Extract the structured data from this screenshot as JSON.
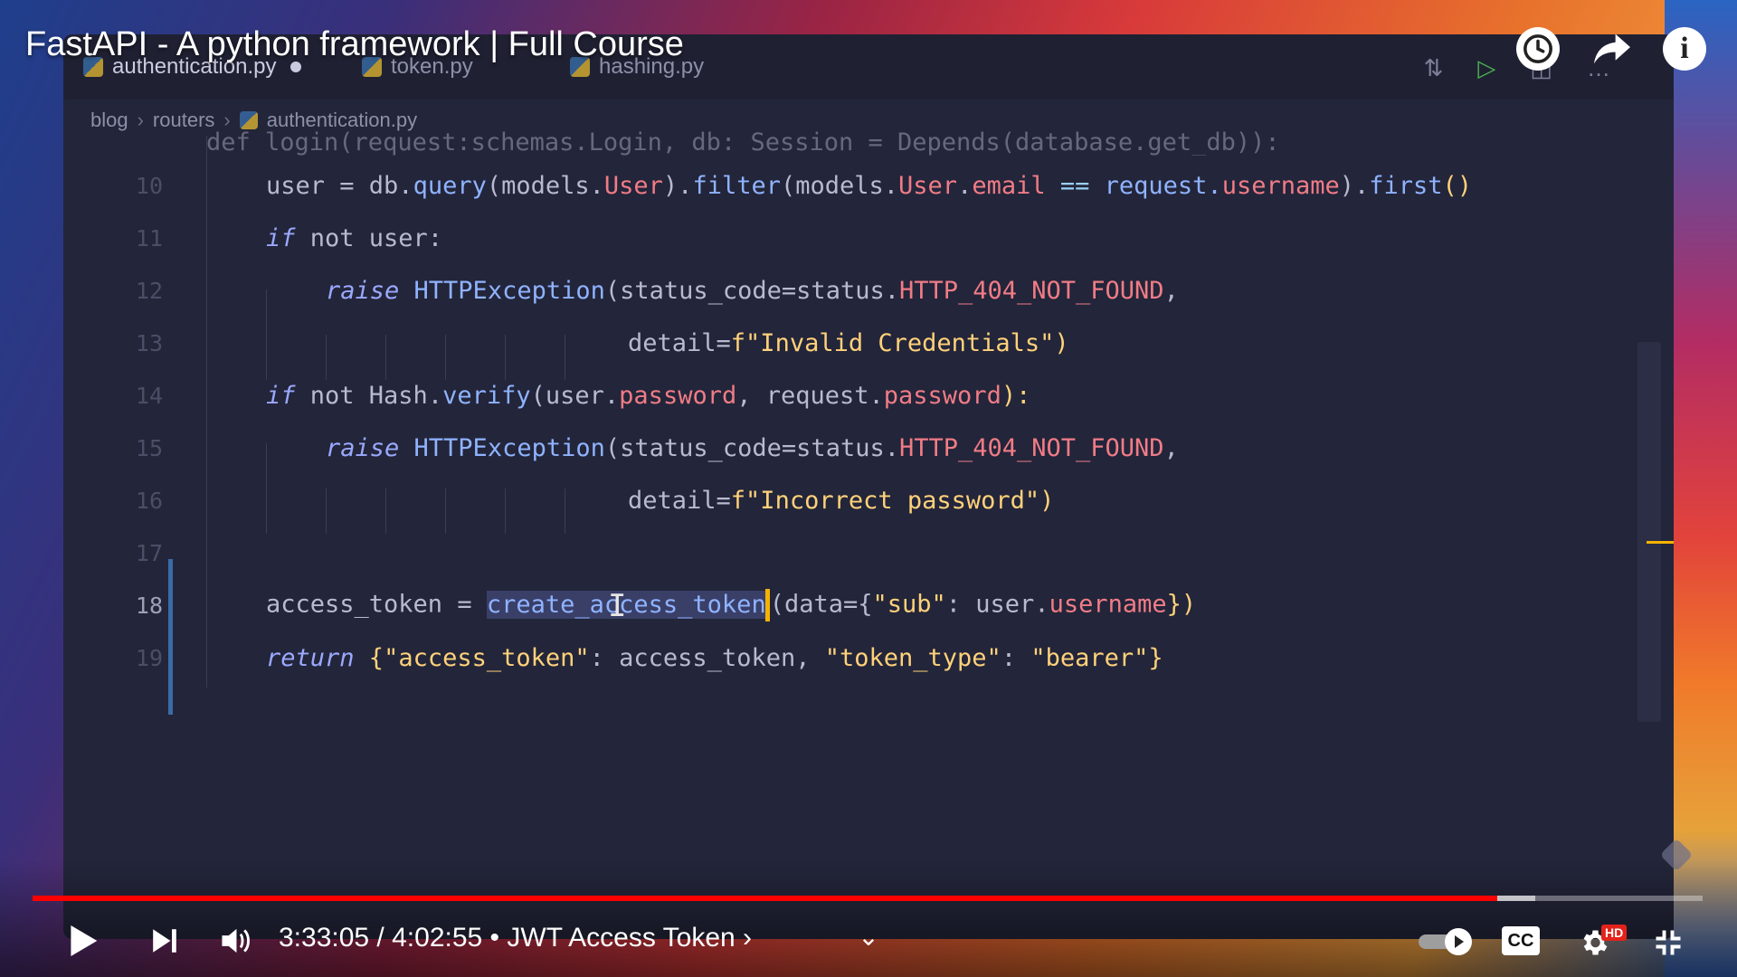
{
  "video": {
    "title": "FastAPI - A python framework | Full Course",
    "time_current": "3:33:05",
    "time_separator": " / ",
    "time_total": "4:02:55",
    "chapter": "• JWT Access Token ›",
    "progress_played": 0.877,
    "progress_buffered_end": 0.9
  },
  "editor": {
    "tabs": [
      {
        "label": "authentication.py",
        "active": true,
        "dirty": true
      },
      {
        "label": "token.py",
        "active": false
      },
      {
        "label": "hashing.py",
        "active": false
      }
    ],
    "breadcrumb": [
      "blog",
      "routers",
      "authentication.py"
    ],
    "partial_line": "def login(request:schemas.Login, db: Session = Depends(database.get_db)):",
    "line_numbers": [
      "10",
      "11",
      "12",
      "13",
      "14",
      "15",
      "16",
      "17",
      "18",
      "19"
    ],
    "lines": {
      "l10_a": "user = db.",
      "l10_b": "query",
      "l10_c": "(models.",
      "l10_d": "User",
      "l10_e": ").",
      "l10_f": "filter",
      "l10_g": "(models.",
      "l10_h": "User",
      "l10_i": ".",
      "l10_j": "email",
      "l10_k": " == ",
      "l10_l": "request.",
      "l10_m": "username",
      "l10_n": ").",
      "l10_o": "first",
      "l10_p": "()",
      "l11_a": "if",
      "l11_b": " not user:",
      "l12_a": "raise",
      "l12_b": " HTTPException",
      "l12_c": "(status_code=status.",
      "l12_d": "HTTP_404_NOT_FOUND",
      "l12_e": ",",
      "l13_a": "detail=",
      "l13_b": "f\"Invalid Credentials\"",
      "l13_c": ")",
      "l14_a": "if",
      "l14_b": " not Hash.",
      "l14_c": "verify",
      "l14_d": "(user.",
      "l14_e": "password",
      "l14_f": ", request.",
      "l14_g": "password",
      "l14_h": "):",
      "l15_a": "raise",
      "l15_b": " HTTPException",
      "l15_c": "(status_code=status.",
      "l15_d": "HTTP_404_NOT_FOUND",
      "l15_e": ",",
      "l16_a": "detail=",
      "l16_b": "f\"Incorrect password\"",
      "l16_c": ")",
      "l18_a": "access_token = ",
      "l18_b": "create_access_token",
      "l18_c": "(data={",
      "l18_d": "\"sub\"",
      "l18_e": ": user.",
      "l18_f": "username",
      "l18_g": "})",
      "l19_a": "return",
      "l19_b": " {",
      "l19_c": "\"access_token\"",
      "l19_d": ": access_token, ",
      "l19_e": "\"token_type\"",
      "l19_f": ": ",
      "l19_g": "\"bearer\"",
      "l19_h": "}"
    }
  },
  "icons": {
    "play": "play-icon",
    "next": "next-icon",
    "volume": "volume-icon",
    "autoplay": "autoplay-toggle-icon",
    "cc": "captions-icon",
    "settings": "settings-icon",
    "fullscreen_exit": "exit-fullscreen-icon",
    "watch_later": "clock-icon",
    "share": "share-icon",
    "info": "info-icon",
    "hd_badge": "HD",
    "cc_label": "CC"
  },
  "colors": {
    "progress_red": "#ff0000",
    "cursor": "#f5b300"
  }
}
